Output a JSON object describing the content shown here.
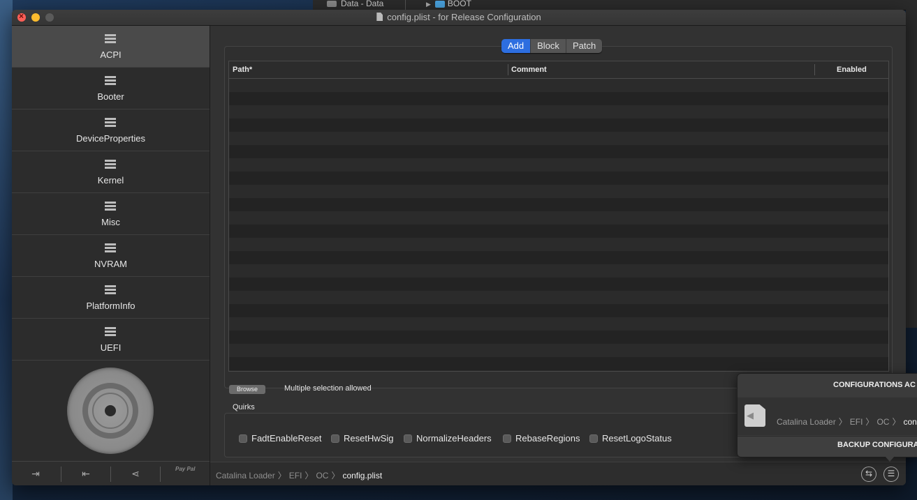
{
  "background_window": {
    "data_label": "Data - Data",
    "folder_label": "BOOT"
  },
  "window": {
    "title": "config.plist - for Release Configuration"
  },
  "sidebar": {
    "items": [
      {
        "label": "ACPI",
        "active": true
      },
      {
        "label": "Booter"
      },
      {
        "label": "DeviceProperties"
      },
      {
        "label": "Kernel"
      },
      {
        "label": "Misc"
      },
      {
        "label": "NVRAM"
      },
      {
        "label": "PlatformInfo"
      },
      {
        "label": "UEFI"
      }
    ],
    "paypal_label": "Pay Pal"
  },
  "main": {
    "tabs": [
      "Add",
      "Block",
      "Patch"
    ],
    "active_tab": "Add",
    "table": {
      "columns": [
        "Path*",
        "Comment",
        "Enabled"
      ],
      "rows": []
    },
    "browse_label": "Browse",
    "multi_selection": "Multiple selection allowed",
    "quirks_title": "Quirks",
    "quirks": [
      {
        "label": "FadtEnableReset",
        "checked": false
      },
      {
        "label": "ResetHwSig",
        "checked": false
      },
      {
        "label": "NormalizeHeaders",
        "checked": false
      },
      {
        "label": "RebaseRegions",
        "checked": false
      },
      {
        "label": "ResetLogoStatus",
        "checked": false
      }
    ]
  },
  "statusbar": {
    "breadcrumb": [
      "Catalina Loader",
      "EFI",
      "OC"
    ],
    "current": "config.plist"
  },
  "popover": {
    "header": "CONFIGURATIONS AC",
    "breadcrumb": [
      "Catalina Loader",
      "EFI",
      "OC"
    ],
    "current": "config",
    "footer": "BACKUP CONFIGURA"
  },
  "colors": {
    "accent": "#2d6ee0",
    "close": "#ff5f57",
    "minimize": "#febc2e"
  }
}
